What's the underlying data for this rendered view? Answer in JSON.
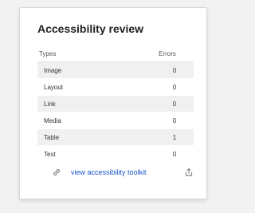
{
  "card": {
    "title": "Accessibility review"
  },
  "table": {
    "headers": [
      "Types",
      "Errors"
    ],
    "rows": [
      {
        "type": "Image",
        "errors": "0"
      },
      {
        "type": "Layout",
        "errors": "0"
      },
      {
        "type": "Link",
        "errors": "0"
      },
      {
        "type": "Media",
        "errors": "0"
      },
      {
        "type": "Table",
        "errors": "1"
      },
      {
        "type": "Text",
        "errors": "0"
      }
    ]
  },
  "footer": {
    "link_label": "view accessibility toolkit",
    "link_icon": "link-icon",
    "export_icon": "export-icon"
  },
  "colors": {
    "link": "#1a56c9",
    "row_stripe": "#f0f0f0"
  }
}
